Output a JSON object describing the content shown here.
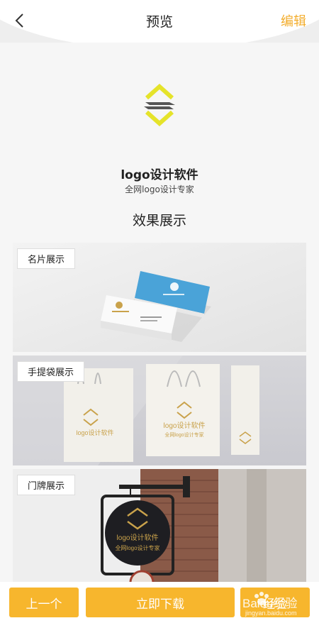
{
  "header": {
    "title": "预览",
    "edit_label": "编辑"
  },
  "logo": {
    "title": "logo设计软件",
    "subtitle": "全网logo设计专家"
  },
  "section": {
    "title": "效果展示"
  },
  "panels": [
    {
      "label": "名片展示"
    },
    {
      "label": "手提袋展示"
    },
    {
      "label": "门牌展示"
    }
  ],
  "mockup": {
    "logo_text": "logo设计软件",
    "logo_sub": "全网logo设计专家"
  },
  "footer": {
    "prev_label": "上一个",
    "download_label": "立即下载",
    "exp_label": "经验"
  },
  "watermark": {
    "text": "Baidu经验",
    "sub": "jingyan.baidu.com"
  },
  "colors": {
    "accent": "#f7b62d",
    "edit": "#f3ad2c",
    "logo_yellow": "#e5e32a",
    "logo_gray": "#555555",
    "card_blue": "#4aa3d8",
    "gold": "#c9a24b"
  },
  "icons": {
    "back": "chevron-left-icon",
    "logo": "logo-mark-icon"
  }
}
